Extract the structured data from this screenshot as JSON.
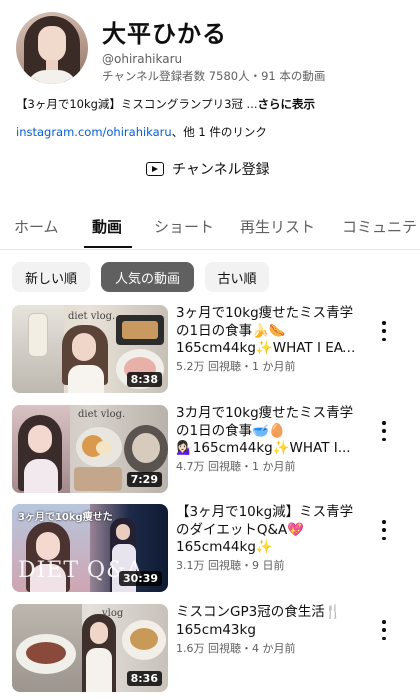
{
  "channel": {
    "name": "大平ひかる",
    "handle": "@ohirahikaru",
    "stats": "チャンネル登録者数 7580人・91 本の動画",
    "description": "【3ヶ月で10kg減】ミスコングランプリ3冠 ...",
    "description_more": "さらに表示",
    "link_url": "instagram.com/ohirahikaru",
    "link_rest": "、他 1 件のリンク",
    "subscribe_label": "チャンネル登録"
  },
  "tabs": [
    {
      "label": "ホーム",
      "active": false
    },
    {
      "label": "動画",
      "active": true
    },
    {
      "label": "ショート",
      "active": false
    },
    {
      "label": "再生リスト",
      "active": false
    },
    {
      "label": "コミュニテ",
      "active": false
    }
  ],
  "chips": [
    {
      "label": "新しい順",
      "selected": false
    },
    {
      "label": "人気の動画",
      "selected": true
    },
    {
      "label": "古い順",
      "selected": false
    }
  ],
  "videos": [
    {
      "title_line1": "3ヶ月で10kg痩せたミス青学",
      "title_line2": "の1日の食事🍌🌭",
      "title_line3": "165cm44kg✨WHAT I EAT...",
      "meta": "5.2万 回視聴・1 か月前",
      "duration": "8:38",
      "thumb_text": "diet vlog."
    },
    {
      "title_line1": "3カ月で10kg痩せたミス青学",
      "title_line2": "の1日の食事🥣🥚",
      "title_line3": "💁🏻‍♀️165cm44kg✨WHAT I...",
      "meta": "4.7万 回視聴・1 か月前",
      "duration": "7:29",
      "thumb_text": "diet vlog."
    },
    {
      "title_line1": "【3ヶ月で10kg減】ミス青学",
      "title_line2": "のダイエットQ&A💖",
      "title_line3": "165cm44kg✨",
      "meta": "3.1万 回視聴・9 日前",
      "duration": "30:39",
      "thumb_text": "3ヶ月で10kg痩せた",
      "thumb_text2": "DIET Q&A"
    },
    {
      "title_line1": "ミスコンGP3冠の食生活🍴",
      "title_line2": "165cm43kg",
      "title_line3": "",
      "meta": "1.6万 回視聴・4 か月前",
      "duration": "8:36",
      "thumb_text": "vlog"
    }
  ]
}
